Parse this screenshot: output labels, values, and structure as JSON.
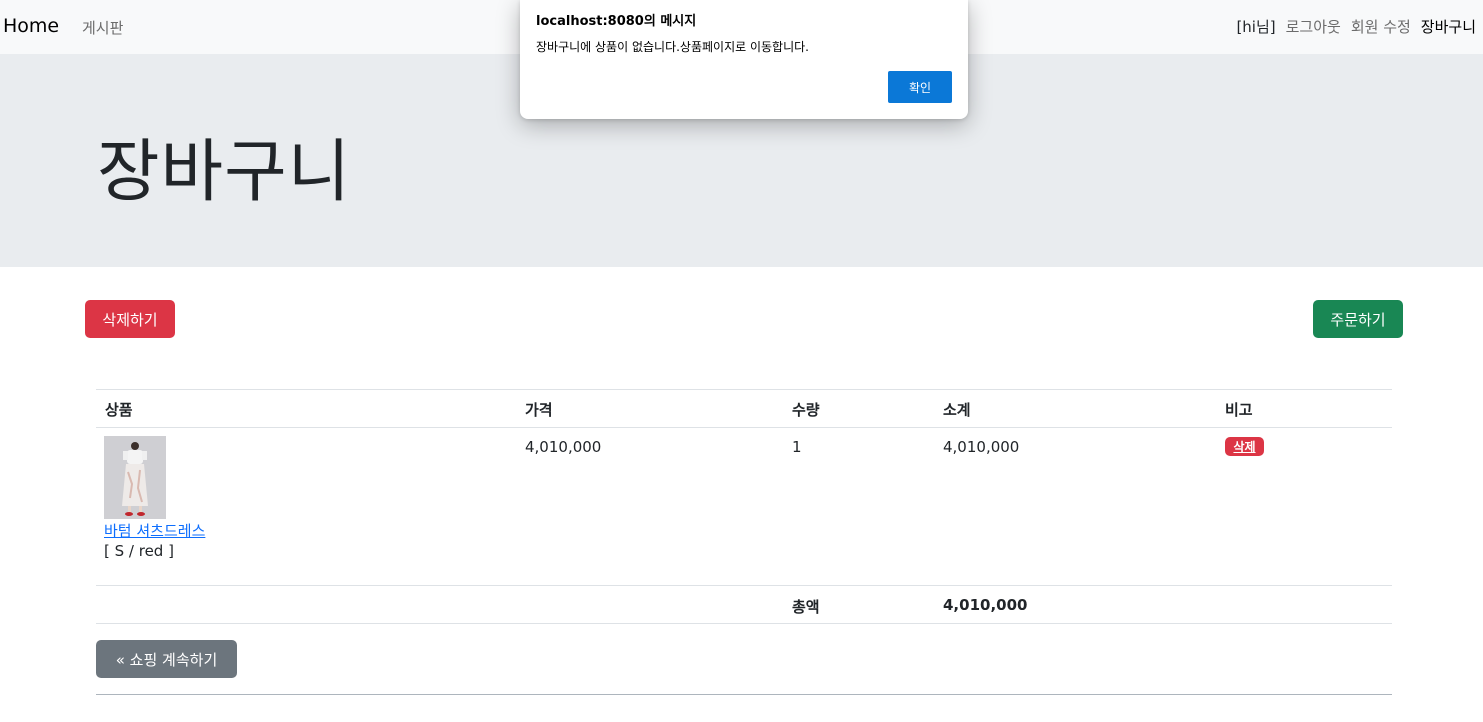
{
  "navbar": {
    "brand": "Home",
    "board": "게시판",
    "greeting": "[hi님]",
    "logout": "로그아웃",
    "edit_member": "회원 수정",
    "cart": "장바구니"
  },
  "jumbotron": {
    "title": "장바구니"
  },
  "actions": {
    "delete_label": "삭제하기",
    "order_label": "주문하기"
  },
  "table": {
    "headers": [
      "상품",
      "가격",
      "수량",
      "소계",
      "비고"
    ],
    "rows": [
      {
        "product_name": "바텀 셔츠드레스",
        "option": "[ S / red ]",
        "price": "4,010,000",
        "quantity": "1",
        "subtotal": "4,010,000",
        "remove_label": "삭제"
      }
    ],
    "total_label": "총액",
    "total_value": "4,010,000"
  },
  "continue_label": "« 쇼핑 계속하기",
  "dialog": {
    "title": "localhost:8080의 메시지",
    "message": "장바구니에 상품이 없습니다.상품페이지로 이동합니다.",
    "ok_label": "확인"
  },
  "colors": {
    "danger": "#dc3545",
    "success": "#198754",
    "secondary": "#6c757d",
    "link": "#0d6efd",
    "dialog_button": "#0b78d7"
  }
}
